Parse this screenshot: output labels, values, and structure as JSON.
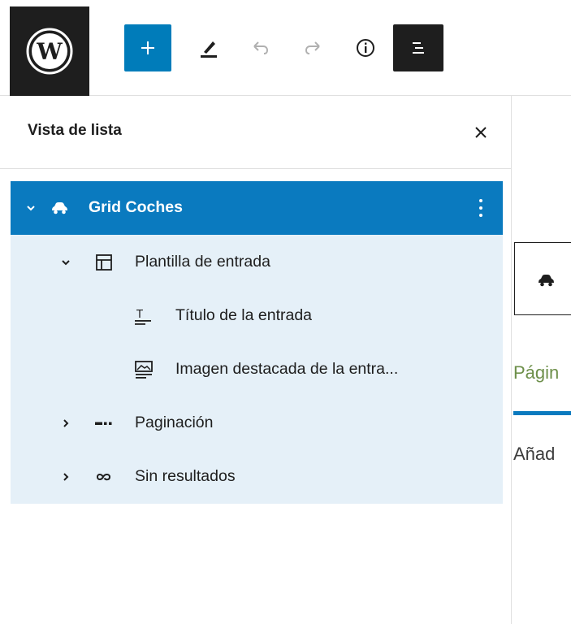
{
  "toolbar": {
    "logo_icon": "wordpress-logo-icon",
    "inserter_icon": "plus-icon",
    "tools_icon": "pencil-icon",
    "undo_icon": "undo-icon",
    "redo_icon": "redo-icon",
    "info_icon": "info-icon",
    "list_view_icon": "list-view-icon",
    "accent_color": "#007cba"
  },
  "list_view": {
    "title": "Vista de lista",
    "close_icon": "close-icon",
    "items": [
      {
        "label": "Grid Coches",
        "icon": "car-icon",
        "expanded": true,
        "selected": true,
        "level": 1
      },
      {
        "label": "Plantilla de entrada",
        "icon": "template-icon",
        "expanded": true,
        "level": 2
      },
      {
        "label": "Título de la entrada",
        "icon": "title-icon",
        "level": 3
      },
      {
        "label": "Imagen destacada de la entra...",
        "icon": "featured-image-icon",
        "level": 3
      },
      {
        "label": "Paginación",
        "icon": "pagination-icon",
        "expanded": false,
        "level": 2
      },
      {
        "label": "Sin resultados",
        "icon": "loop-icon",
        "expanded": false,
        "level": 2
      }
    ],
    "selected_color": "#0a7abf",
    "tree_bg_color": "#e5f0f8"
  },
  "canvas": {
    "pagination_text": "Págin",
    "no_results_text": "Añad"
  }
}
